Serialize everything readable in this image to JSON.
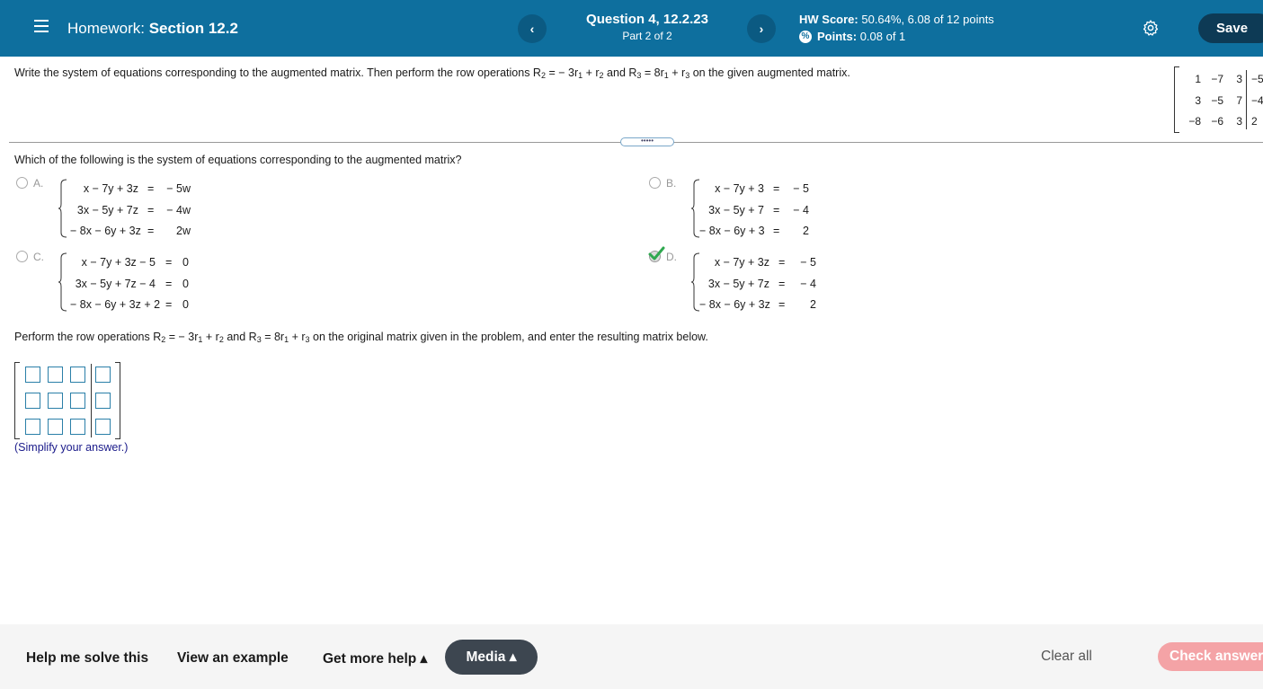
{
  "header": {
    "hw_prefix": "Homework:",
    "hw_section": "Section 12.2",
    "prev_label": "‹",
    "next_label": "›",
    "question_title": "Question 4, 12.2.23",
    "question_part": "Part 2 of 2",
    "hw_score_label": "HW Score:",
    "hw_score_value": "50.64%, 6.08 of 12 points",
    "points_label": "Points:",
    "points_value": "0.08 of 1",
    "save_label": "Save"
  },
  "problem": {
    "instruction_parts": [
      "Write the system of equations corresponding to the augmented matrix. Then perform the row operations R",
      "2",
      " = − 3r",
      "1",
      " + r",
      "2",
      " and R",
      "3",
      " = 8r",
      "1",
      " + r",
      "3",
      " on the given augmented matrix."
    ],
    "given_matrix": [
      [
        "1",
        "−7",
        "3",
        "−5"
      ],
      [
        "3",
        "−5",
        "7",
        "−4"
      ],
      [
        "−8",
        "−6",
        "3",
        "2"
      ]
    ],
    "divider_label": "•••••",
    "question": "Which of the following is the system of equations corresponding to the augmented matrix?",
    "options": [
      {
        "letter": "A.",
        "selected": false,
        "rows": [
          [
            "x − 7y + 3z",
            "=",
            "− 5w"
          ],
          [
            "3x − 5y + 7z",
            "=",
            "− 4w"
          ],
          [
            "− 8x − 6y + 3z",
            "=",
            "2w"
          ]
        ]
      },
      {
        "letter": "B.",
        "selected": false,
        "rows": [
          [
            "x − 7y + 3",
            "=",
            "− 5"
          ],
          [
            "3x − 5y + 7",
            "=",
            "− 4"
          ],
          [
            "− 8x − 6y + 3",
            "=",
            "2"
          ]
        ]
      },
      {
        "letter": "C.",
        "selected": false,
        "rows": [
          [
            "x − 7y + 3z − 5",
            "=",
            "0"
          ],
          [
            "3x − 5y + 7z − 4",
            "=",
            "0"
          ],
          [
            "− 8x − 6y + 3z + 2",
            "=",
            "0"
          ]
        ]
      },
      {
        "letter": "D.",
        "selected": true,
        "rows": [
          [
            "x − 7y + 3z",
            "=",
            "− 5"
          ],
          [
            "3x − 5y + 7z",
            "=",
            "− 4"
          ],
          [
            "− 8x − 6y + 3z",
            "=",
            "2"
          ]
        ]
      }
    ],
    "perform_parts": [
      "Perform the row operations R",
      "2",
      " = − 3r",
      "1",
      " + r",
      "2",
      " and R",
      "3",
      " = 8r",
      "1",
      " + r",
      "3",
      " on the original matrix given in the problem, and enter the resulting matrix below."
    ],
    "simplify_note": "(Simplify your answer.)"
  },
  "footer": {
    "help_solve": "Help me solve this",
    "view_example": "View an example",
    "get_more_help": "Get more help ▴",
    "media": "Media ▴",
    "clear_all": "Clear all",
    "check_answer": "Check answer"
  },
  "colors": {
    "header_bg": "#0e6f9e",
    "save_bg": "#0d3a55",
    "check_answer_bg": "#f4a3a6",
    "correct_check": "#2fa84f"
  }
}
